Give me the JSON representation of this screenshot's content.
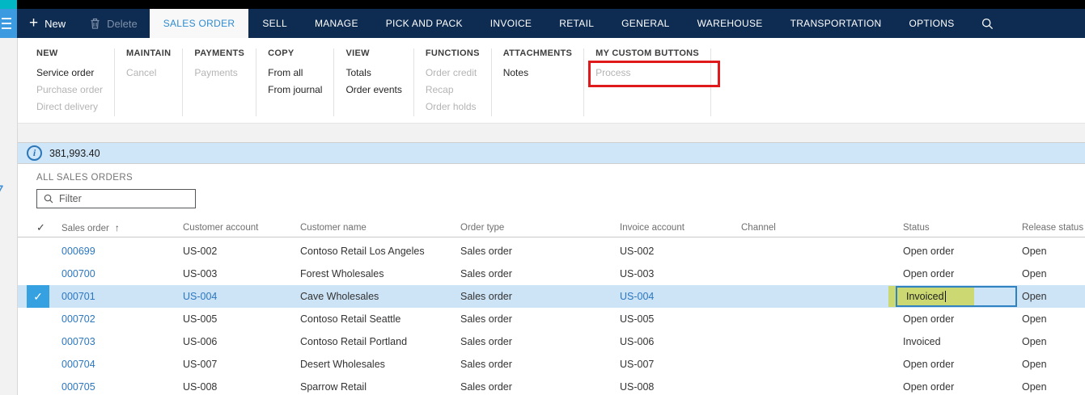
{
  "topbar": {
    "new_label": "New",
    "delete_label": "Delete",
    "active_tab": "SALES ORDER",
    "tabs": [
      "SELL",
      "MANAGE",
      "PICK AND PACK",
      "INVOICE",
      "RETAIL",
      "GENERAL",
      "WAREHOUSE",
      "TRANSPORTATION",
      "OPTIONS"
    ]
  },
  "ribbon": {
    "groups": [
      {
        "name": "NEW",
        "items": [
          {
            "label": "Service order",
            "enabled": true
          },
          {
            "label": "Purchase order",
            "enabled": false
          },
          {
            "label": "Direct delivery",
            "enabled": false
          }
        ]
      },
      {
        "name": "MAINTAIN",
        "items": [
          {
            "label": "Cancel",
            "enabled": false
          }
        ]
      },
      {
        "name": "PAYMENTS",
        "items": [
          {
            "label": "Payments",
            "enabled": false
          }
        ]
      },
      {
        "name": "COPY",
        "items": [
          {
            "label": "From all",
            "enabled": true
          },
          {
            "label": "From journal",
            "enabled": true
          }
        ]
      },
      {
        "name": "VIEW",
        "items": [
          {
            "label": "Totals",
            "enabled": true
          },
          {
            "label": "Order events",
            "enabled": true
          }
        ]
      },
      {
        "name": "FUNCTIONS",
        "items": [
          {
            "label": "Order credit",
            "enabled": false
          },
          {
            "label": "Recap",
            "enabled": false
          },
          {
            "label": "Order holds",
            "enabled": false
          }
        ]
      },
      {
        "name": "ATTACHMENTS",
        "items": [
          {
            "label": "Notes",
            "enabled": true
          }
        ]
      },
      {
        "name": "MY CUSTOM BUTTONS",
        "items": [
          {
            "label": "Process",
            "enabled": false,
            "highlighted": true
          }
        ]
      }
    ]
  },
  "infobar": {
    "value": "381,993.40"
  },
  "list": {
    "title": "ALL SALES ORDERS",
    "filter_placeholder": "Filter",
    "sort_column": "Sales order",
    "columns": [
      "Sales order",
      "Customer account",
      "Customer name",
      "Order type",
      "Invoice account",
      "Channel",
      "Status",
      "Release status"
    ],
    "rows": [
      {
        "sales_order": "000699",
        "customer_account": "US-002",
        "customer_name": "Contoso Retail Los Angeles",
        "order_type": "Sales order",
        "invoice_account": "US-002",
        "channel": "",
        "status": "Open order",
        "release_status": "Open",
        "selected": false,
        "editing": false
      },
      {
        "sales_order": "000700",
        "customer_account": "US-003",
        "customer_name": "Forest Wholesales",
        "order_type": "Sales order",
        "invoice_account": "US-003",
        "channel": "",
        "status": "Open order",
        "release_status": "Open",
        "selected": false,
        "editing": false
      },
      {
        "sales_order": "000701",
        "customer_account": "US-004",
        "customer_name": "Cave Wholesales",
        "order_type": "Sales order",
        "invoice_account": "US-004",
        "channel": "",
        "status": "Invoiced",
        "release_status": "Open",
        "selected": true,
        "editing": true
      },
      {
        "sales_order": "000702",
        "customer_account": "US-005",
        "customer_name": "Contoso Retail Seattle",
        "order_type": "Sales order",
        "invoice_account": "US-005",
        "channel": "",
        "status": "Open order",
        "release_status": "Open",
        "selected": false,
        "editing": false
      },
      {
        "sales_order": "000703",
        "customer_account": "US-006",
        "customer_name": "Contoso Retail Portland",
        "order_type": "Sales order",
        "invoice_account": "US-006",
        "channel": "",
        "status": "Invoiced",
        "release_status": "Open",
        "selected": false,
        "editing": false
      },
      {
        "sales_order": "000704",
        "customer_account": "US-007",
        "customer_name": "Desert Wholesales",
        "order_type": "Sales order",
        "invoice_account": "US-007",
        "channel": "",
        "status": "Open order",
        "release_status": "Open",
        "selected": false,
        "editing": false
      },
      {
        "sales_order": "000705",
        "customer_account": "US-008",
        "customer_name": "Sparrow Retail",
        "order_type": "Sales order",
        "invoice_account": "US-008",
        "channel": "",
        "status": "Open order",
        "release_status": "Open",
        "selected": false,
        "editing": false
      }
    ]
  },
  "colors": {
    "navy": "#0e2c52",
    "teal": "#00b7c3",
    "hamburger_blue": "#3c9be0",
    "active_tab_text": "#2e8bd0",
    "infobar_bg": "#cfe5f8",
    "selection_bg": "#cde3f6",
    "check_square": "#36a1e1",
    "link_blue": "#2b77c0",
    "edit_highlight": "#ccd972",
    "edit_border": "#2f81c0",
    "annotation_red": "#e01a1a"
  },
  "icons": {
    "hamburger": "menu lines",
    "new": "plus",
    "delete": "trash-can",
    "search": "magnifier",
    "info": "circled-i",
    "sort_ascending": "up-arrow",
    "select": "checkmark"
  }
}
